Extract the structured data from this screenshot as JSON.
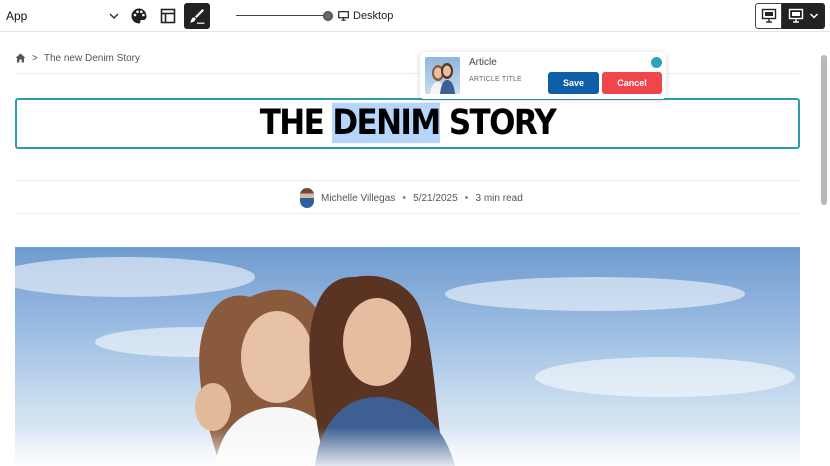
{
  "toolbar": {
    "app_select_value": "App",
    "device_label": "Desktop",
    "icons": [
      "chevron-down-icon",
      "palette-icon",
      "layout-icon",
      "edit-brush-icon",
      "desktop-icon",
      "preview-icon",
      "publish-icon"
    ]
  },
  "breadcrumb": {
    "home_icon": "home-icon",
    "separator": ">",
    "current": "The new Denim Story"
  },
  "article": {
    "title_before": "THE ",
    "title_selected": "DENIM",
    "title_after": " STORY",
    "author": "Michelle Villegas",
    "separator": "•",
    "date": "5/21/2025",
    "read_time": "3 min read"
  },
  "popover": {
    "type_label": "Article",
    "field_label": "ARTICLE TITLE",
    "save_label": "Save",
    "cancel_label": "Cancel",
    "status_color": "#2fa3b6"
  },
  "colors": {
    "accent": "#2d9cb0",
    "save": "#0f5fa8",
    "cancel": "#f0454c",
    "selection": "#b6d5fb"
  }
}
